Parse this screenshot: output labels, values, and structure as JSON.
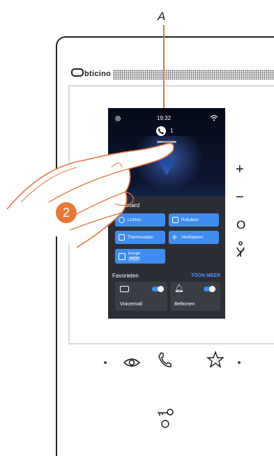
{
  "callout": {
    "label": "A"
  },
  "device": {
    "brand": "bticino",
    "side_buttons": {
      "plus": "+",
      "minus": "−",
      "circle_label": "O"
    },
    "bottom_icons": [
      "eye-icon",
      "handset-icon",
      "star-icon"
    ],
    "key_icon": "key-icon"
  },
  "screen": {
    "status": {
      "time": "19:32"
    },
    "calls": {
      "count": "1"
    },
    "dashboard": {
      "title": "Dashboard",
      "tiles": [
        {
          "label": "Lichten",
          "icon": "bulb-icon"
        },
        {
          "label": "Rolluiken",
          "icon": "shutter-icon"
        },
        {
          "label": "Thermostaten",
          "icon": "thermostat-icon"
        },
        {
          "label": "Ventilatoren",
          "icon": "fan-icon"
        }
      ],
      "energy": {
        "label": "Energie",
        "value": "842W"
      }
    },
    "favorites": {
      "title": "Favorieten",
      "more": "TOON MEER",
      "items": [
        {
          "label": "Voicemail",
          "icon": "voicemail-icon",
          "on": true
        },
        {
          "label": "Beltonen",
          "icon": "bell-icon",
          "on": true
        }
      ]
    }
  },
  "step_badge": {
    "number": "2"
  },
  "colors": {
    "accent": "#3f8cf0",
    "callout": "#e8733a",
    "badge": "#e87934"
  }
}
